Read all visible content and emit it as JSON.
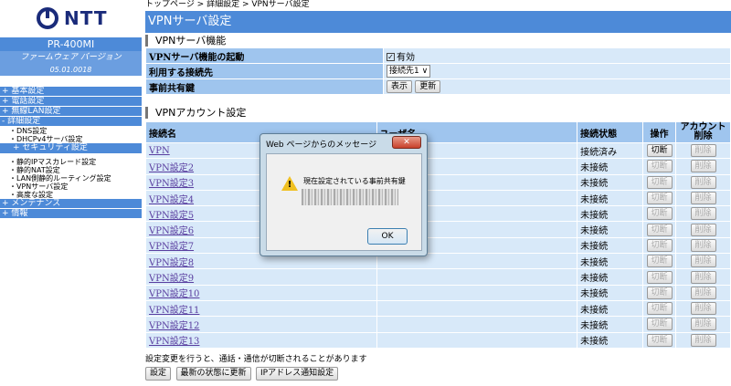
{
  "brand": {
    "logo_text": "NTT",
    "model": "PR-400MI",
    "fw_label": "ファームウェア バージョン",
    "fw_version": "05.01.0018"
  },
  "nav": {
    "basic": "+ 基本設定",
    "phone": "+ 電話設定",
    "wlan": "+ 無線LAN設定",
    "detail": "- 詳細設定",
    "dns": "・DNS設定",
    "dhcp": "・DHCPv4サーバ設定",
    "security": "+ セキュリティ設定",
    "static_masq": "・静的IPマスカレード設定",
    "static_nat": "・静的NAT設定",
    "lan_routing": "・LAN側静的ルーティング設定",
    "vpn_server": "・VPNサーバ設定",
    "advanced": "・高度な設定",
    "maintenance": "+ メンテナンス",
    "info": "+ 情報"
  },
  "breadcrumb": "トップページ > 詳細設定 > VPNサーバ設定",
  "page_title": "VPNサーバ設定",
  "func_section": {
    "heading": "VPNサーバ機能",
    "enable_label": "VPNサーバ機能の起動",
    "enable_value": "有効",
    "enable_checked": true,
    "conn_label": "利用する接続先",
    "conn_value": "接続先1",
    "psk_label": "事前共有鍵",
    "show_btn": "表示",
    "change_btn": "更新"
  },
  "acct_section": {
    "heading": "VPNアカウント設定",
    "col_name": "接続名",
    "col_user": "ユーザ名",
    "col_status": "接続状態",
    "col_op": "操作",
    "col_del_1": "アカウント",
    "col_del_2": "削除",
    "rows": [
      {
        "name": "VPN",
        "user": "",
        "status": "接続済み",
        "op": "切断",
        "del": "削除"
      },
      {
        "name": "VPN設定2",
        "user": "",
        "status": "未接続",
        "op": "切断",
        "del": "削除"
      },
      {
        "name": "VPN設定3",
        "user": "",
        "status": "未接続",
        "op": "切断",
        "del": "削除"
      },
      {
        "name": "VPN設定4",
        "user": "",
        "status": "未接続",
        "op": "切断",
        "del": "削除"
      },
      {
        "name": "VPN設定5",
        "user": "",
        "status": "未接続",
        "op": "切断",
        "del": "削除"
      },
      {
        "name": "VPN設定6",
        "user": "",
        "status": "未接続",
        "op": "切断",
        "del": "削除"
      },
      {
        "name": "VPN設定7",
        "user": "",
        "status": "未接続",
        "op": "切断",
        "del": "削除"
      },
      {
        "name": "VPN設定8",
        "user": "",
        "status": "未接続",
        "op": "切断",
        "del": "削除"
      },
      {
        "name": "VPN設定9",
        "user": "",
        "status": "未接続",
        "op": "切断",
        "del": "削除"
      },
      {
        "name": "VPN設定10",
        "user": "",
        "status": "未接続",
        "op": "切断",
        "del": "削除"
      },
      {
        "name": "VPN設定11",
        "user": "",
        "status": "未接続",
        "op": "切断",
        "del": "削除"
      },
      {
        "name": "VPN設定12",
        "user": "",
        "status": "未接続",
        "op": "切断",
        "del": "削除"
      },
      {
        "name": "VPN設定13",
        "user": "",
        "status": "未接続",
        "op": "切断",
        "del": "削除"
      }
    ]
  },
  "footer": {
    "note": "設定変更を行うと、通話・通信が切断されることがあります",
    "set_btn": "設定",
    "refresh_btn": "最新の状態に更新",
    "ip_notify_btn": "IPアドレス通知設定"
  },
  "dialog": {
    "title": "Web ページからのメッセージ",
    "close": "✕",
    "message": "現在設定されている事前共有鍵",
    "ok": "OK"
  },
  "colors": {
    "header_blue": "#4d8ad8",
    "label_bg": "#9fc5ee",
    "cell_bg": "#d8e9f9",
    "warning": "#f0c020"
  }
}
